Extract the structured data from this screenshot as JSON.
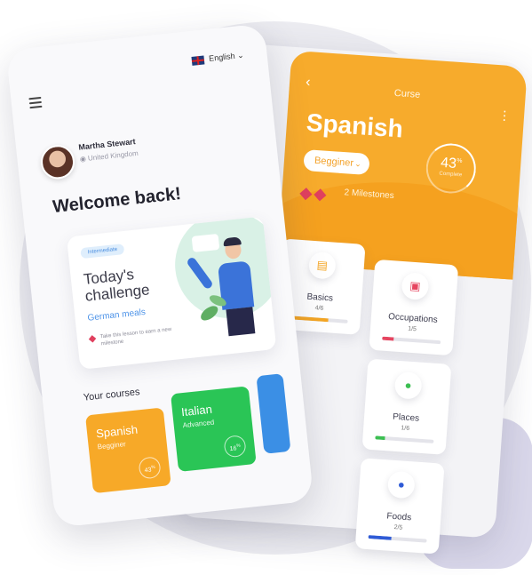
{
  "back_screen": {
    "title": "Curse",
    "language": "Spanish",
    "level": "Begginer",
    "progress_percent": 43,
    "progress_display": "43",
    "progress_unit": "%",
    "progress_caption": "Complete",
    "milestones": "2 Milestones",
    "categories": [
      {
        "name": "Basics",
        "count": "4/6",
        "progress": 0.67,
        "color": "#f5a623",
        "icon": "document-icon"
      },
      {
        "name": "Occupations",
        "count": "1/5",
        "progress": 0.2,
        "color": "#e64560",
        "icon": "briefcase-icon"
      },
      {
        "name": "Places",
        "count": "1/6",
        "progress": 0.17,
        "color": "#3cbf52",
        "icon": "location-pin-icon"
      },
      {
        "name": "Foods",
        "count": "2/5",
        "progress": 0.4,
        "color": "#2f5bd6",
        "icon": "apple-icon"
      }
    ]
  },
  "front_screen": {
    "language_selector": "English",
    "user": {
      "name": "Martha Stewart",
      "location": "United Kingdom"
    },
    "welcome": "Welcome back!",
    "challenge": {
      "tag": "Intermediate",
      "title": "Today's challenge",
      "subtitle": "German meals",
      "hint": "Take this lesson to earn a new milestone"
    },
    "courses_heading": "Your courses",
    "courses": [
      {
        "name": "Spanish",
        "level": "Begginer",
        "progress": "43",
        "color": "#f7a928"
      },
      {
        "name": "Italian",
        "level": "Advanced",
        "progress": "16",
        "color": "#2ac556"
      }
    ]
  }
}
